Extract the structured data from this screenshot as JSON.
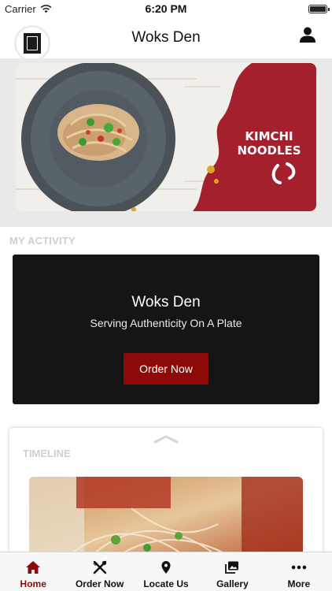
{
  "status_bar": {
    "carrier": "Carrier",
    "time": "6:20 PM"
  },
  "header": {
    "title": "Woks Den"
  },
  "hero": {
    "banner_text_line1": "KIMCHI",
    "banner_text_line2": "NOODLES"
  },
  "my_activity": {
    "section_label": "MY ACTIVITY",
    "card_title": "Woks Den",
    "card_tagline": "Serving Authenticity On A Plate",
    "order_button": "Order Now"
  },
  "timeline": {
    "section_label": "TIMELINE"
  },
  "tab_bar": {
    "items": [
      {
        "label": "Home",
        "icon": "home-icon",
        "active": true
      },
      {
        "label": "Order Now",
        "icon": "utensils-icon",
        "active": false
      },
      {
        "label": "Locate Us",
        "icon": "location-pin-icon",
        "active": false
      },
      {
        "label": "Gallery",
        "icon": "gallery-icon",
        "active": false
      },
      {
        "label": "More",
        "icon": "more-dots-icon",
        "active": false
      }
    ]
  },
  "colors": {
    "brand_red": "#8e0a09",
    "banner_red": "#a3202c",
    "card_dark": "#151515"
  }
}
